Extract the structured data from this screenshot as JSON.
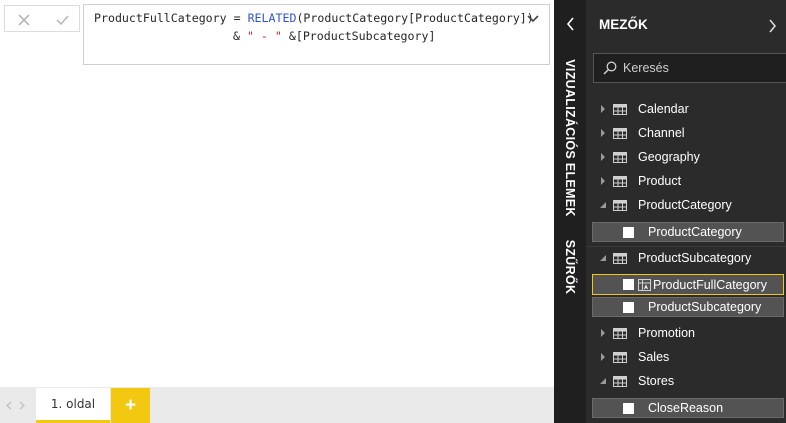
{
  "formula_bar": {
    "cancel_icon": "close-icon",
    "commit_icon": "check-icon",
    "line1": {
      "p1": "ProductFullCategory = ",
      "kw": "RELATED",
      "p2": "(ProductCategory[ProductCategory])"
    },
    "line2": {
      "p1": "& ",
      "s1": "\" - \"",
      "p2": " &[ProductSubcategory]"
    },
    "expand_icon": "chevron-down-icon"
  },
  "page_tabs": {
    "nav_icons": [
      "chevron-left-icon",
      "chevron-right-icon"
    ],
    "tabs": [
      {
        "label": "1. oldal",
        "active": true
      }
    ],
    "add_label": "+",
    "accent": "#f2c811"
  },
  "side_panes": {
    "collapse_icon": "chevron-left-icon",
    "visualizations_label": "VIZUALIZÁCIÓS ELEMEK",
    "filters_label": "SZŰRŐK"
  },
  "fields_pane": {
    "title": "MEZŐK",
    "expand_icon": "chevron-right-icon",
    "search_placeholder": "Keresés",
    "search_icon": "search-icon",
    "tables": [
      {
        "name": "Calendar",
        "expanded": false
      },
      {
        "name": "Channel",
        "expanded": false
      },
      {
        "name": "Geography",
        "expanded": false
      },
      {
        "name": "Product",
        "expanded": false
      },
      {
        "name": "ProductCategory",
        "expanded": true,
        "fields": [
          "ProductCategory"
        ]
      },
      {
        "name": "ProductSubcategory",
        "expanded": true,
        "fields": [
          "ProductFullCategory",
          "ProductSubcategory"
        ]
      },
      {
        "name": "Promotion",
        "expanded": false
      },
      {
        "name": "Sales",
        "expanded": false
      },
      {
        "name": "Stores",
        "expanded": true,
        "fields": [
          "CloseReason"
        ]
      }
    ],
    "selected_field": "ProductFullCategory",
    "selected_field_icon": "calculated-column-icon",
    "colors": {
      "background": "#2b2b2b",
      "field_bg": "#535353",
      "highlight": "#f2c811"
    }
  }
}
